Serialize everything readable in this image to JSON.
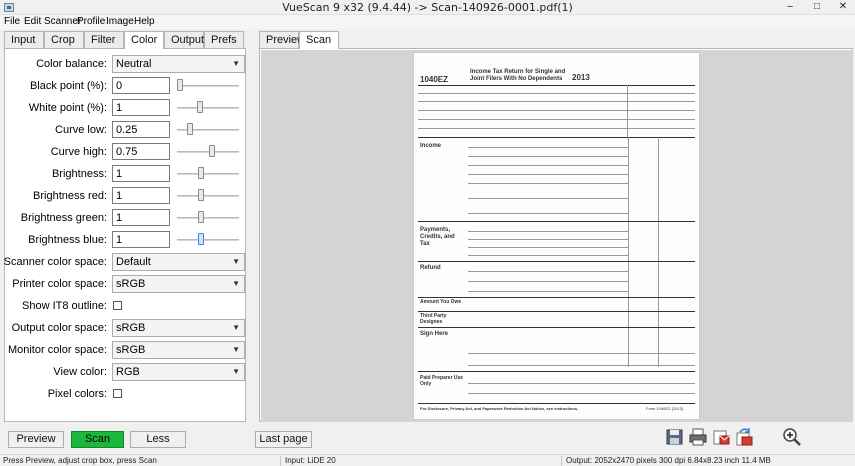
{
  "window": {
    "title": "VueScan 9 x32 (9.4.44) -> Scan-140926-0001.pdf(1)",
    "controls": [
      "–",
      "□",
      "✕"
    ]
  },
  "menu": [
    "File",
    "Edit",
    "Scanner",
    "Profile",
    "Image",
    "Help"
  ],
  "left_tabs": [
    {
      "label": "Input",
      "active": false
    },
    {
      "label": "Crop",
      "active": false
    },
    {
      "label": "Filter",
      "active": false
    },
    {
      "label": "Color",
      "active": true
    },
    {
      "label": "Output",
      "active": false
    },
    {
      "label": "Prefs",
      "active": false
    }
  ],
  "right_tabs": [
    {
      "label": "Preview",
      "active": false
    },
    {
      "label": "Scan",
      "active": true
    }
  ],
  "color_settings": {
    "color_balance": {
      "label": "Color balance:",
      "value": "Neutral"
    },
    "black_point": {
      "label": "Black point (%):",
      "value": "0",
      "slider": 0.0
    },
    "white_point": {
      "label": "White point (%):",
      "value": "1",
      "slider": 0.5
    },
    "curve_low": {
      "label": "Curve low:",
      "value": "0.25",
      "slider": 0.25
    },
    "curve_high": {
      "label": "Curve high:",
      "value": "0.75",
      "slider": 0.75
    },
    "brightness": {
      "label": "Brightness:",
      "value": "1",
      "slider": 0.5
    },
    "brightness_red": {
      "label": "Brightness red:",
      "value": "1",
      "slider": 0.5
    },
    "brightness_green": {
      "label": "Brightness green:",
      "value": "1",
      "slider": 0.5
    },
    "brightness_blue": {
      "label": "Brightness blue:",
      "value": "1",
      "slider": 0.5
    },
    "scanner_color_space": {
      "label": "Scanner color space:",
      "value": "Default"
    },
    "printer_color_space": {
      "label": "Printer color space:",
      "value": "sRGB"
    },
    "show_it8_outline": {
      "label": "Show IT8 outline:",
      "checked": false
    },
    "output_color_space": {
      "label": "Output color space:",
      "value": "sRGB"
    },
    "monitor_color_space": {
      "label": "Monitor color space:",
      "value": "sRGB"
    },
    "view_color": {
      "label": "View color:",
      "value": "RGB"
    },
    "pixel_colors": {
      "label": "Pixel colors:",
      "checked": false
    }
  },
  "document": {
    "form_number": "1040EZ",
    "form_title_line1": "Income Tax Return for Single and",
    "form_title_line2": "Joint Filers With No Dependents",
    "year": "2013",
    "sections": [
      "Income",
      "Payments, Credits, and Tax",
      "Refund",
      "Amount You Owe",
      "Third Party Designee",
      "Sign Here",
      "Paid Preparer Use Only"
    ],
    "footer_left": "For Disclosure, Privacy Act, and Paperwork Reduction Act Notice, see instructions.",
    "footer_right": "Form 1040EZ (2013)"
  },
  "buttons": {
    "preview": "Preview",
    "scan": "Scan",
    "less": "Less",
    "last_page": "Last page"
  },
  "toolbar_icons": [
    "save-icon",
    "print-icon",
    "email-icon",
    "rotate-icon",
    "zoom-in-icon"
  ],
  "status": {
    "left": "Press Preview, adjust crop box, press Scan",
    "middle": "Input: LiDE 20",
    "right": "Output: 2052x2470 pixels 300 dpi 6.84x8.23 inch 11.4 MB"
  },
  "colors": {
    "scan_button": "#1cb83e",
    "panel_bg": "#f0f0f0",
    "scan_area_bg": "#d4d4d4"
  }
}
